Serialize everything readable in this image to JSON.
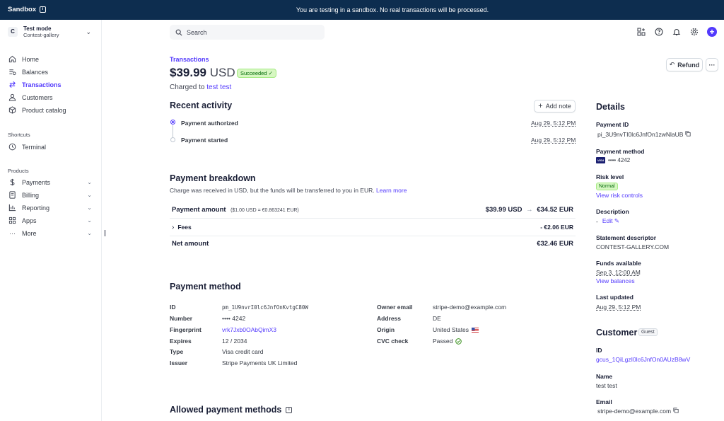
{
  "banner": {
    "label": "Sandbox",
    "message": "You are testing in a sandbox. No real transactions will be processed."
  },
  "account": {
    "initial": "C",
    "mode": "Test mode",
    "name": "Contest-gallery"
  },
  "nav": {
    "home": "Home",
    "balances": "Balances",
    "transactions": "Transactions",
    "customers": "Customers",
    "product_catalog": "Product catalog",
    "shortcuts_heading": "Shortcuts",
    "terminal": "Terminal",
    "products_heading": "Products",
    "payments": "Payments",
    "billing": "Billing",
    "reporting": "Reporting",
    "apps": "Apps",
    "more": "More"
  },
  "search": {
    "placeholder": "Search"
  },
  "header": {
    "breadcrumb": "Transactions",
    "amount": "$39.99",
    "currency": "USD",
    "status": "Succeeded",
    "charged_prefix": "Charged to",
    "customer_link": "test test",
    "refund": "Refund",
    "more": "···"
  },
  "activity": {
    "title": "Recent activity",
    "add_note": "Add note",
    "items": [
      {
        "label": "Payment authorized",
        "date": "Aug 29, 5:12 PM"
      },
      {
        "label": "Payment started",
        "date": "Aug 29, 5:12 PM"
      }
    ]
  },
  "breakdown": {
    "title": "Payment breakdown",
    "subtitle": "Charge was received in USD, but the funds will be transferred to you in EUR.",
    "learn_more": "Learn more",
    "payment_amount_label": "Payment amount",
    "rate": "($1.00 USD = €0.863241 EUR)",
    "payment_amount_usd": "$39.99 USD",
    "arrow": "→",
    "payment_amount_eur": "€34.52 EUR",
    "fees_label": "Fees",
    "fees_value": "- €2.06 EUR",
    "net_label": "Net amount",
    "net_value": "€32.46 EUR"
  },
  "payment_method": {
    "title": "Payment method",
    "left": [
      {
        "label": "ID",
        "value": "pm_1U9nvrI0lc6JnfOnKvtgC80W"
      },
      {
        "label": "Number",
        "value": "•••• 4242"
      },
      {
        "label": "Fingerprint",
        "value": "vrk7Jxb0OAbQimX3"
      },
      {
        "label": "Expires",
        "value": "12 / 2034"
      },
      {
        "label": "Type",
        "value": "Visa credit card"
      },
      {
        "label": "Issuer",
        "value": "Stripe Payments UK Limited"
      }
    ],
    "right": [
      {
        "label": "Owner email",
        "value": "stripe-demo@example.com"
      },
      {
        "label": "Address",
        "value": "DE"
      },
      {
        "label": "Origin",
        "value": "United States"
      },
      {
        "label": "CVC check",
        "value": "Passed"
      }
    ]
  },
  "allowed": {
    "title": "Allowed payment methods"
  },
  "details": {
    "title": "Details",
    "payment_id_label": "Payment ID",
    "payment_id": "pi_3U9nvTI0lc6JnfOn1zwNlaUB",
    "method_label": "Payment method",
    "card_brand": "VISA",
    "card_last4": "•••• 4242",
    "risk_label": "Risk level",
    "risk_value": "Normal",
    "risk_link": "View risk controls",
    "desc_label": "Description",
    "desc_value": "-",
    "desc_edit": "Edit",
    "statement_label": "Statement descriptor",
    "statement_value": "CONTEST-GALLERY.COM",
    "funds_label": "Funds available",
    "funds_value": "Sep 3, 12:00 AM",
    "funds_link": "View balances",
    "updated_label": "Last updated",
    "updated_value": "Aug 29, 5:12 PM"
  },
  "customer": {
    "title": "Customer",
    "badge": "Guest",
    "id_label": "ID",
    "id_value": "gcus_1QiLgzI0lc6JnfOn0AUzB8wV",
    "name_label": "Name",
    "name_value": "test test",
    "email_label": "Email",
    "email_value": "stripe-demo@example.com"
  },
  "colors": {
    "accent": "#533afd",
    "banner": "#0d2d4f",
    "success": "#006908"
  }
}
